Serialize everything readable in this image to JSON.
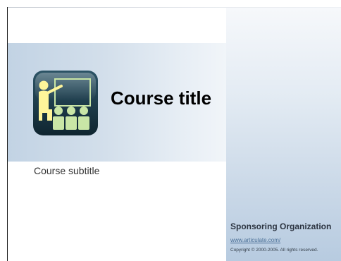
{
  "slide": {
    "title": "Course title",
    "subtitle": "Course subtitle",
    "logo_icon": "teacher-presentation-icon"
  },
  "footer": {
    "sponsor": "Sponsoring Organization",
    "link": "www.articulate.com/",
    "copyright": "Copyright © 2000-2005. All rights reserved."
  },
  "colors": {
    "title_band": "#c2d3e4",
    "right_panel_bottom": "#b7cbe0",
    "logo_background": "#1c3a45",
    "logo_figures": "#c9e6a6",
    "logo_teacher": "#fff59a"
  }
}
